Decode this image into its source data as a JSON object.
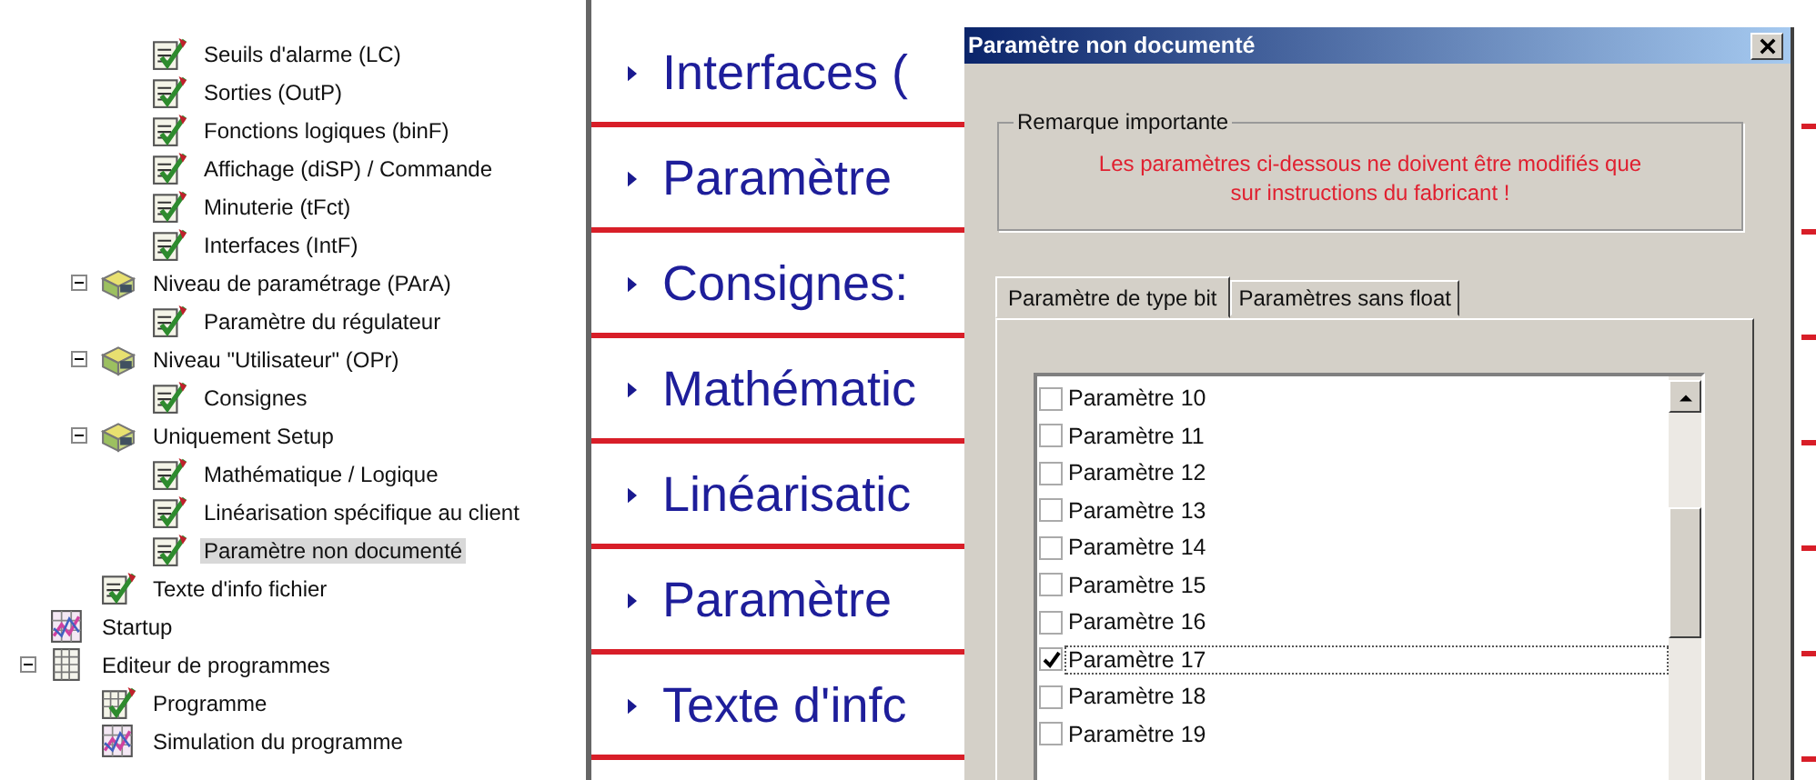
{
  "tree": [
    {
      "children": [
        {
          "children": [
            {
              "label": "Seuils d'alarme (LC)",
              "kind": "param"
            },
            {
              "label": "Sorties (OutP)",
              "kind": "param"
            },
            {
              "label": "Fonctions logiques (binF)",
              "kind": "param"
            },
            {
              "label": "Affichage (diSP) / Commande",
              "kind": "param"
            },
            {
              "label": "Minuterie (tFct)",
              "kind": "param"
            },
            {
              "label": "Interfaces (IntF)",
              "kind": "param"
            }
          ]
        },
        {
          "label": "Niveau de paramétrage (PArA)",
          "kind": "group",
          "expanded": true,
          "children": [
            {
              "label": "Paramètre du régulateur",
              "kind": "param"
            }
          ]
        },
        {
          "label": "Niveau \"Utilisateur\" (OPr)",
          "kind": "group",
          "expanded": true,
          "children": [
            {
              "label": "Consignes",
              "kind": "param"
            }
          ]
        },
        {
          "label": "Uniquement Setup",
          "kind": "group",
          "expanded": true,
          "children": [
            {
              "label": "Mathématique / Logique",
              "kind": "param"
            },
            {
              "label": "Linéarisation spécifique au client",
              "kind": "param"
            },
            {
              "label": "Paramètre non documenté",
              "kind": "param",
              "selected": true
            }
          ]
        },
        {
          "label": "Texte d'info fichier",
          "kind": "param"
        }
      ]
    },
    {
      "label": "Startup",
      "kind": "chart"
    },
    {
      "label": "Editeur de programmes",
      "kind": "table",
      "expanded": true,
      "children": [
        {
          "label": "Programme",
          "kind": "tableparam"
        },
        {
          "label": "Simulation du programme",
          "kind": "chart"
        }
      ]
    }
  ],
  "headings": [
    "Interfaces (",
    "Paramètre",
    "Consignes:",
    "Mathématic",
    "Linéarisatic",
    "Paramètre",
    "Texte d'infc"
  ],
  "dialog": {
    "title": "Paramètre non documenté",
    "group_title": "Remarque importante",
    "warning": "Les paramètres ci-dessous ne doivent être modifiés que sur instructions du fabricant !",
    "tabs": [
      {
        "label": "Paramètre de type bit",
        "selected": true
      },
      {
        "label": "Paramètres sans float",
        "selected": false
      }
    ],
    "items": [
      {
        "label": "Paramètre 10",
        "checked": false,
        "selected": false
      },
      {
        "label": "Paramètre 11",
        "checked": false,
        "selected": false
      },
      {
        "label": "Paramètre 12",
        "checked": false,
        "selected": false
      },
      {
        "label": "Paramètre 13",
        "checked": false,
        "selected": false
      },
      {
        "label": "Paramètre 14",
        "checked": false,
        "selected": false
      },
      {
        "label": "Paramètre 15",
        "checked": false,
        "selected": false
      },
      {
        "label": "Paramètre 16",
        "checked": false,
        "selected": false
      },
      {
        "label": "Paramètre 17",
        "checked": true,
        "selected": true
      },
      {
        "label": "Paramètre 18",
        "checked": false,
        "selected": false
      },
      {
        "label": "Paramètre 19",
        "checked": false,
        "selected": false
      }
    ]
  }
}
